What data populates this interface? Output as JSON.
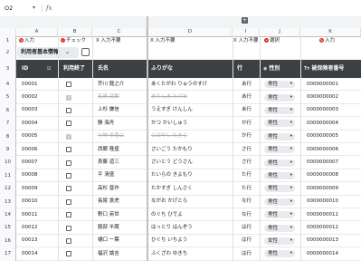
{
  "formula_bar": {
    "cell_ref": "O2",
    "fx": "fx"
  },
  "columns": [
    "A",
    "B",
    "C",
    "D",
    "I",
    "J",
    "K"
  ],
  "row_numbers": [
    "1",
    "2",
    "3",
    "4",
    "5",
    "6",
    "7",
    "8",
    "9",
    "10",
    "11",
    "12",
    "13",
    "14",
    "15",
    "16",
    "17"
  ],
  "annotations": [
    {
      "icon": "✎",
      "text": "入力"
    },
    {
      "icon": "✓",
      "text": "チェック"
    },
    {
      "icon": "",
      "text": "X 入力不要"
    },
    {
      "icon": "",
      "text": "X 入力不要"
    },
    {
      "icon": "",
      "text": "X 入力不要"
    },
    {
      "icon": "•",
      "text": "選択"
    },
    {
      "icon": "✎",
      "text": "入力"
    }
  ],
  "tab": {
    "label": "利用者基本情報",
    "caret": "⌄"
  },
  "headers": {
    "id": "ID",
    "ended": "利用終了",
    "name": "氏名",
    "furigana": "ふりがな",
    "gyo": "行",
    "gender": "性別",
    "insured": "被保険者番号"
  },
  "rows": [
    {
      "id": "00001",
      "ended": false,
      "name": "芥川 龍之介",
      "furi": "あくたがわ りゅうのすけ",
      "gyo": "あ行",
      "gender": "男性",
      "ins": "0000000001"
    },
    {
      "id": "00002",
      "ended": true,
      "name": "有島 武郎",
      "furi": "ありしま たけお",
      "gyo": "あ行",
      "gender": "男性",
      "ins": "0000000002"
    },
    {
      "id": "00003",
      "ended": false,
      "name": "上杉 謙信",
      "furi": "うえすぎ けんしん",
      "gyo": "あ行",
      "gender": "男性",
      "ins": "0000000003"
    },
    {
      "id": "00004",
      "ended": false,
      "name": "勝 海舟",
      "furi": "かつ かいしゅう",
      "gyo": "か行",
      "gender": "男性",
      "ins": "0000000004"
    },
    {
      "id": "00005",
      "ended": true,
      "name": "小林 多喜二",
      "furi": "こばやし たきじ",
      "gyo": "か行",
      "gender": "男性",
      "ins": "0000000005"
    },
    {
      "id": "00006",
      "ended": false,
      "name": "西郷 隆盛",
      "furi": "さいごう たかもり",
      "gyo": "さ行",
      "gender": "男性",
      "ins": "0000000006"
    },
    {
      "id": "00007",
      "ended": false,
      "name": "斎藤 道三",
      "furi": "さいとう どうさん",
      "gyo": "さ行",
      "gender": "男性",
      "ins": "0000000007"
    },
    {
      "id": "00008",
      "ended": false,
      "name": "平 清盛",
      "furi": "たいらの きよもり",
      "gyo": "た行",
      "gender": "男性",
      "ins": "0000000008"
    },
    {
      "id": "00009",
      "ended": false,
      "name": "高杉 晋作",
      "furi": "たかすぎ しんさく",
      "gyo": "た行",
      "gender": "男性",
      "ins": "0000000009"
    },
    {
      "id": "00010",
      "ended": false,
      "name": "長尾 景虎",
      "furi": "ながお かげとら",
      "gyo": "な行",
      "gender": "男性",
      "ins": "0000000010"
    },
    {
      "id": "00011",
      "ended": false,
      "name": "野口 英世",
      "furi": "のぐち ひでよ",
      "gyo": "な行",
      "gender": "男性",
      "ins": "0000000011"
    },
    {
      "id": "00012",
      "ended": false,
      "name": "服部 半蔵",
      "furi": "はっとり はんぞう",
      "gyo": "は行",
      "gender": "男性",
      "ins": "0000000012"
    },
    {
      "id": "00013",
      "ended": false,
      "name": "樋口 一葉",
      "furi": "ひぐち いちよう",
      "gyo": "は行",
      "gender": "女性",
      "ins": "0000000013"
    },
    {
      "id": "00014",
      "ended": false,
      "name": "福沢 諭吉",
      "furi": "ふくざわ ゆきち",
      "gyo": "は行",
      "gender": "男性",
      "ins": "0000000014"
    }
  ]
}
